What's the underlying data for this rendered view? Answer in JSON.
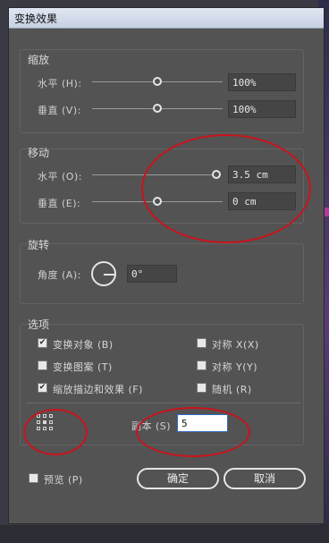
{
  "window": {
    "title": "变换效果"
  },
  "scale": {
    "title": "缩放",
    "horizontal": {
      "label": "水平 (H):",
      "value": "100%",
      "slider_level": 0.5
    },
    "vertical": {
      "label": "垂直 (V):",
      "value": "100%",
      "slider_level": 0.5
    }
  },
  "move": {
    "title": "移动",
    "horizontal": {
      "label": "水平 (O):",
      "value": "3.5 cm",
      "slider_level": 1.0
    },
    "vertical": {
      "label": "垂直 (E):",
      "value": "0 cm",
      "slider_level": 0.5
    }
  },
  "rotate": {
    "title": "旋转",
    "angle": {
      "label": "角度 (A):",
      "value": "0°"
    }
  },
  "options": {
    "title": "选项",
    "transform_objects": {
      "label": "变换对象 (B)",
      "checked": true
    },
    "transform_patterns": {
      "label": "变换图案 (T)",
      "checked": false
    },
    "scale_strokes": {
      "label": "缩放描边和效果 (F)",
      "checked": true
    },
    "reflect_x": {
      "label": "对称 X(X)",
      "checked": false
    },
    "reflect_y": {
      "label": "对称 Y(Y)",
      "checked": false
    },
    "random": {
      "label": "随机 (R)",
      "checked": false
    }
  },
  "copies": {
    "label": "副本 (S)",
    "value": "5"
  },
  "preview": {
    "label": "预览 (P)",
    "checked": false
  },
  "buttons": {
    "ok": "确定",
    "cancel": "取消"
  },
  "icons": {
    "reference_point": "reference-point-grid-icon",
    "angle_dial": "angle-dial-icon",
    "checkmark": "✔"
  },
  "colors": {
    "annotation_red": "#c8141c",
    "dialog_bg": "#535353"
  }
}
